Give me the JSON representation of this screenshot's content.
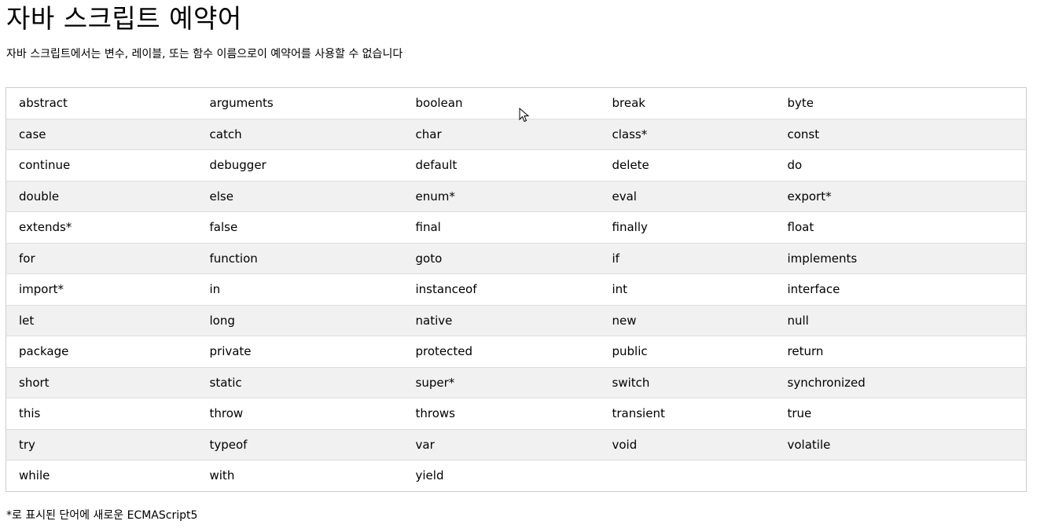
{
  "header": {
    "title": "자바 스크립트 예약어"
  },
  "intro": {
    "text": "자바 스크립트에서는 변수, 레이블, 또는 함수 이름으로이 예약어를 사용할 수 없습니다"
  },
  "table": {
    "rows": [
      [
        "abstract",
        "arguments",
        "boolean",
        "break",
        "byte"
      ],
      [
        "case",
        "catch",
        "char",
        "class*",
        "const"
      ],
      [
        "continue",
        "debugger",
        "default",
        "delete",
        "do"
      ],
      [
        "double",
        "else",
        "enum*",
        "eval",
        "export*"
      ],
      [
        "extends*",
        "false",
        "final",
        "finally",
        "float"
      ],
      [
        "for",
        "function",
        "goto",
        "if",
        "implements"
      ],
      [
        "import*",
        "in",
        "instanceof",
        "int",
        "interface"
      ],
      [
        "let",
        "long",
        "native",
        "new",
        "null"
      ],
      [
        "package",
        "private",
        "protected",
        "public",
        "return"
      ],
      [
        "short",
        "static",
        "super*",
        "switch",
        "synchronized"
      ],
      [
        "this",
        "throw",
        "throws",
        "transient",
        "true"
      ],
      [
        "try",
        "typeof",
        "var",
        "void",
        "volatile"
      ],
      [
        "while",
        "with",
        "yield",
        "",
        ""
      ]
    ]
  },
  "footnote": {
    "text": "*로 표시된 단어에 새로운 ECMAScript5"
  },
  "cursor": {
    "icon": "mouse-pointer-icon"
  }
}
